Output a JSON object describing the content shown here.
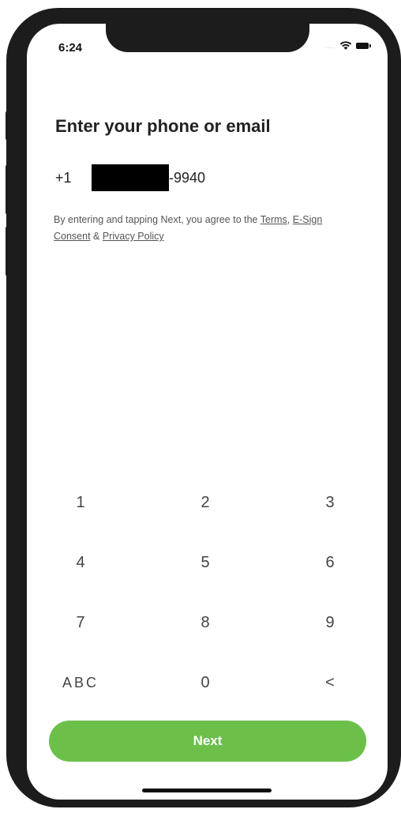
{
  "status_bar": {
    "time": "6:24",
    "signal_dots": "....",
    "icons": [
      "wifi-icon",
      "battery-icon"
    ]
  },
  "main": {
    "title": "Enter your phone or email",
    "country_code": "+1",
    "phone_suffix": "-9940",
    "legal": {
      "prefix": "By entering and tapping Next, you agree to the ",
      "terms": "Terms",
      "sep1": ", ",
      "esign": "E-Sign Consent",
      "sep2": " & ",
      "privacy": "Privacy Policy"
    }
  },
  "keypad": {
    "keys": [
      "1",
      "2",
      "3",
      "4",
      "5",
      "6",
      "7",
      "8",
      "9",
      "ABC",
      "0",
      "<"
    ]
  },
  "next_button": {
    "label": "Next",
    "color": "#6cc04a"
  }
}
